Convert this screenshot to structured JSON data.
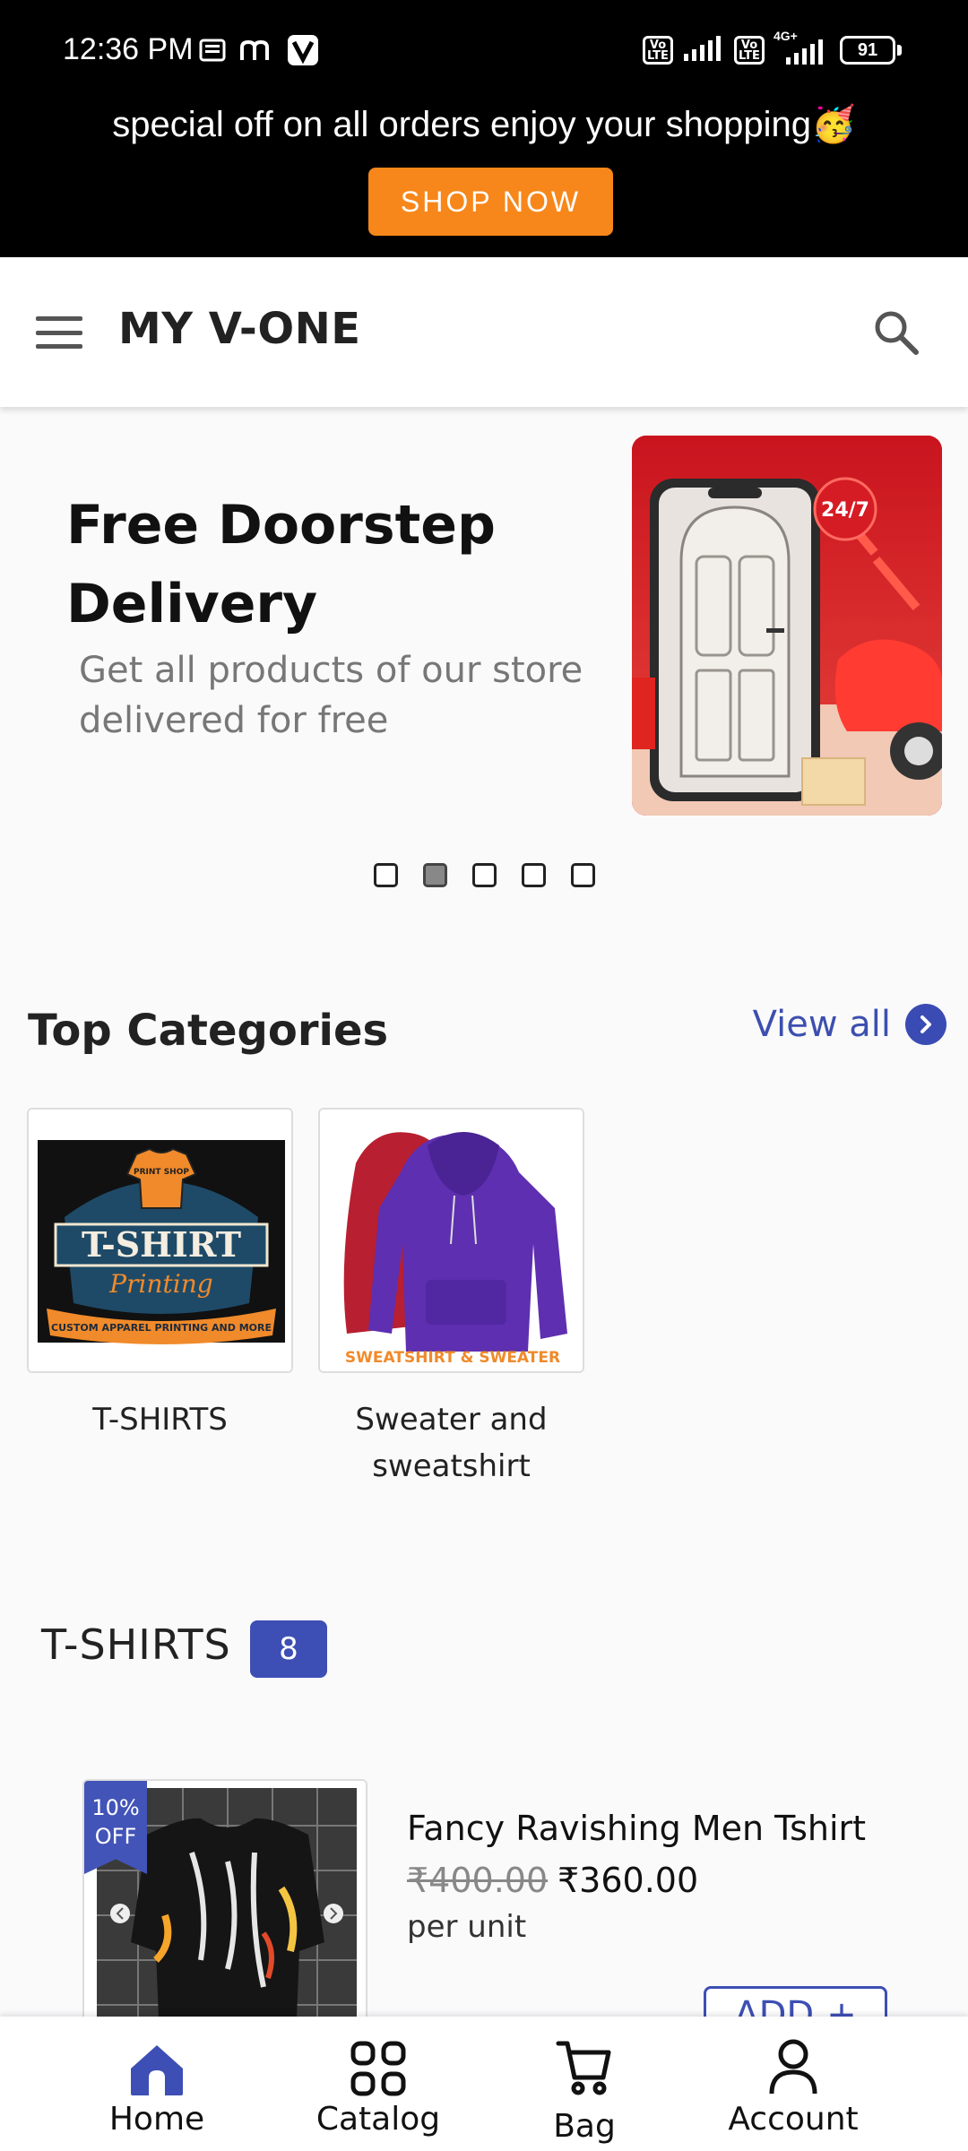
{
  "status_bar": {
    "time": "12:36 PM",
    "battery": "91",
    "volte1": "Vo LTE",
    "volte2": "Vo LTE",
    "network": "4G+"
  },
  "promo": {
    "text": "special off on all orders enjoy your shopping🥳",
    "button": "SHOP NOW",
    "button_color": "#f7871a"
  },
  "header": {
    "menu_icon": "hamburger-menu-icon",
    "title": "MY V-ONE",
    "search_icon": "search-icon"
  },
  "banner": {
    "heading": "Free Doorstep Delivery",
    "subtext": "Get all products of our store delivered for free",
    "image_label": "24/7",
    "slide_count": 5,
    "active_slide": 2
  },
  "categories": {
    "title": "Top Categories",
    "view_all": "View all",
    "items": [
      {
        "label": "T-SHIRTS",
        "image_text": "T-SHIRT",
        "image_sub": "Printing",
        "image_caption": "CUSTOM APPAREL PRINTING AND MORE",
        "image_top": "PRINT SHOP"
      },
      {
        "label": "Sweater and sweatshirt",
        "image_caption": "SWEATSHIRT & SWEATER"
      }
    ]
  },
  "tshirts_section": {
    "title": "T-SHIRTS",
    "count": "8",
    "product": {
      "discount": "10% OFF",
      "discount_line1": "10%",
      "discount_line2": "OFF",
      "name": "Fancy Ravishing Men Tshirt",
      "old_price": "₹400.00",
      "new_price": "₹360.00",
      "unit": "per unit",
      "add_label": "ADD",
      "add_plus": "+"
    }
  },
  "bottom_nav": {
    "items": [
      {
        "label": "Home",
        "icon": "home-icon"
      },
      {
        "label": "Catalog",
        "icon": "grid-icon"
      },
      {
        "label": "Bag",
        "icon": "cart-icon"
      },
      {
        "label": "Account",
        "icon": "person-icon"
      }
    ],
    "accent": "#3d4fb4"
  }
}
